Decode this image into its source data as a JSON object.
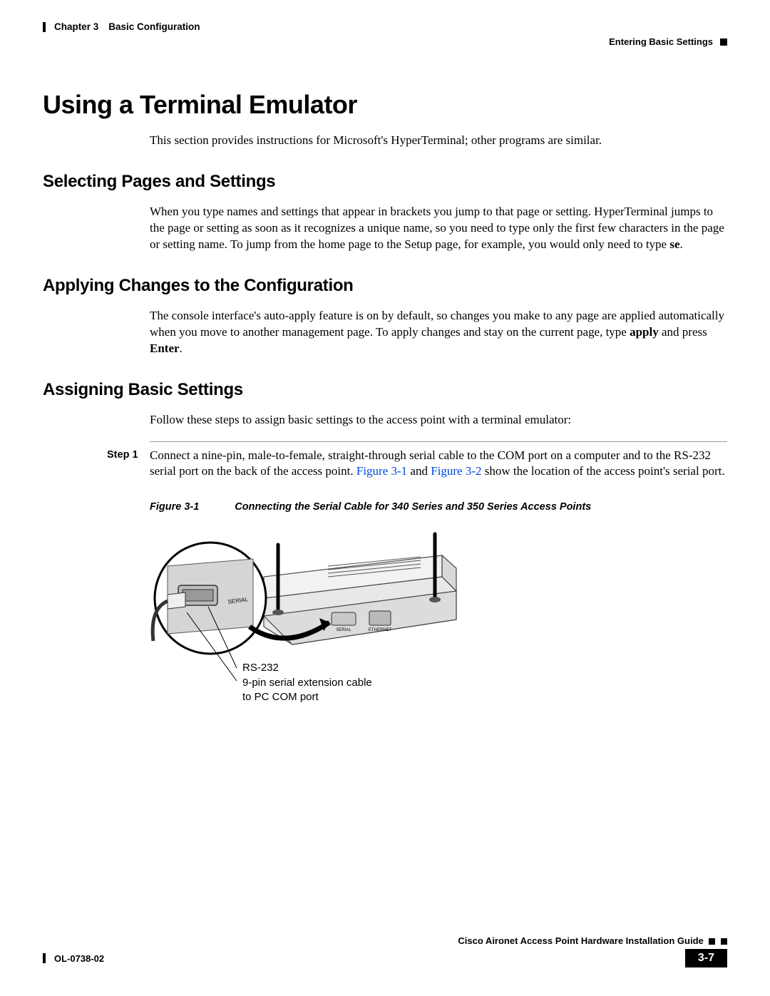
{
  "header": {
    "chapter": "Chapter 3",
    "chapter_title": "Basic Configuration",
    "section": "Entering Basic Settings"
  },
  "h1": "Using a Terminal Emulator",
  "intro": "This section provides instructions for Microsoft's HyperTerminal; other programs are similar.",
  "sec1": {
    "title": "Selecting Pages and Settings",
    "p1a": "When you type names and settings that appear in brackets you jump to that page or setting. HyperTerminal jumps to the page or setting as soon as it recognizes a unique name, so you need to type only the first few characters in the page or setting name. To jump from the home page to the Setup page, for example, you would only need to type ",
    "p1b": "se",
    "p1c": "."
  },
  "sec2": {
    "title": "Applying Changes to the Configuration",
    "p1a": "The console interface's auto-apply feature is on by default, so changes you make to any page are applied automatically when you move to another management page. To apply changes and stay on the current page, type ",
    "p1b": "apply",
    "p1c": " and press ",
    "p1d": "Enter",
    "p1e": "."
  },
  "sec3": {
    "title": "Assigning Basic Settings",
    "intro": "Follow these steps to assign basic settings to the access point with a terminal emulator:",
    "step1_label": "Step 1",
    "step1_a": "Connect a nine-pin, male-to-female, straight-through serial cable to the COM port on a computer and to the RS-232 serial port on the back of the access point. ",
    "step1_link1": "Figure 3-1",
    "step1_mid": " and ",
    "step1_link2": "Figure 3-2",
    "step1_b": " show the location of the access point's serial port."
  },
  "figure": {
    "label": "Figure 3-1",
    "caption": "Connecting the Serial Cable for 340 Series and 350 Series Access Points",
    "callout1": "RS-232",
    "callout2": "9-pin serial extension cable to PC COM port",
    "port_serial": "SERIAL",
    "port_ethernet": "ETHERNET"
  },
  "footer": {
    "guide": "Cisco Aironet Access Point Hardware Installation Guide",
    "doc_id": "OL-0738-02",
    "page_num": "3-7"
  }
}
